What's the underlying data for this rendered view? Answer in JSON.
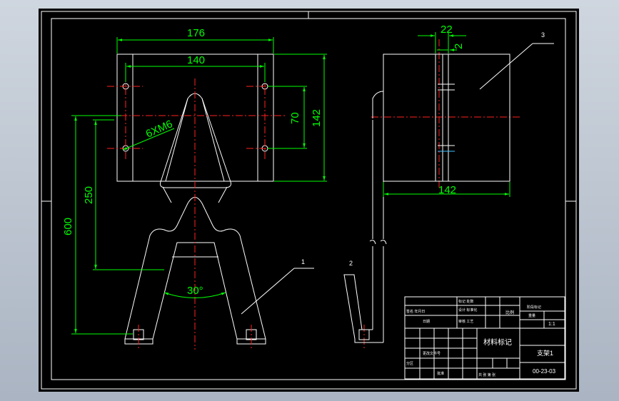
{
  "drawing": {
    "dimensions": {
      "outer_width": "176",
      "inner_width": "140",
      "hole_pitch_v": "70",
      "plate_height": "142",
      "holes": "6XM6",
      "height_250": "250",
      "height_600": "600",
      "angle": "30°",
      "top_width": "22",
      "slot": "2",
      "side_width": "142"
    },
    "balloons": {
      "b1": "1",
      "b2": "2",
      "b3": "3"
    }
  },
  "title_block": {
    "material_label": "材料标记",
    "part_name": "支架1",
    "drawing_no": "00-23-03",
    "scale_label": "比例",
    "scale_value": "1:1",
    "small": {
      "r1": "标记 处数",
      "r2": "设计 标准化",
      "r3": "审核 工艺",
      "c1": "签名 年月日",
      "c2": "阶段标记",
      "c3": "重量",
      "c4": "共 张 第 张",
      "c5": "日期",
      "c6": "更改文件号",
      "c7": "分区",
      "c8": "批准"
    }
  },
  "colors": {
    "background": "#000000",
    "lines": "#ffffff",
    "dimensions": "#00ff00",
    "centerlines": "#ff2020"
  }
}
